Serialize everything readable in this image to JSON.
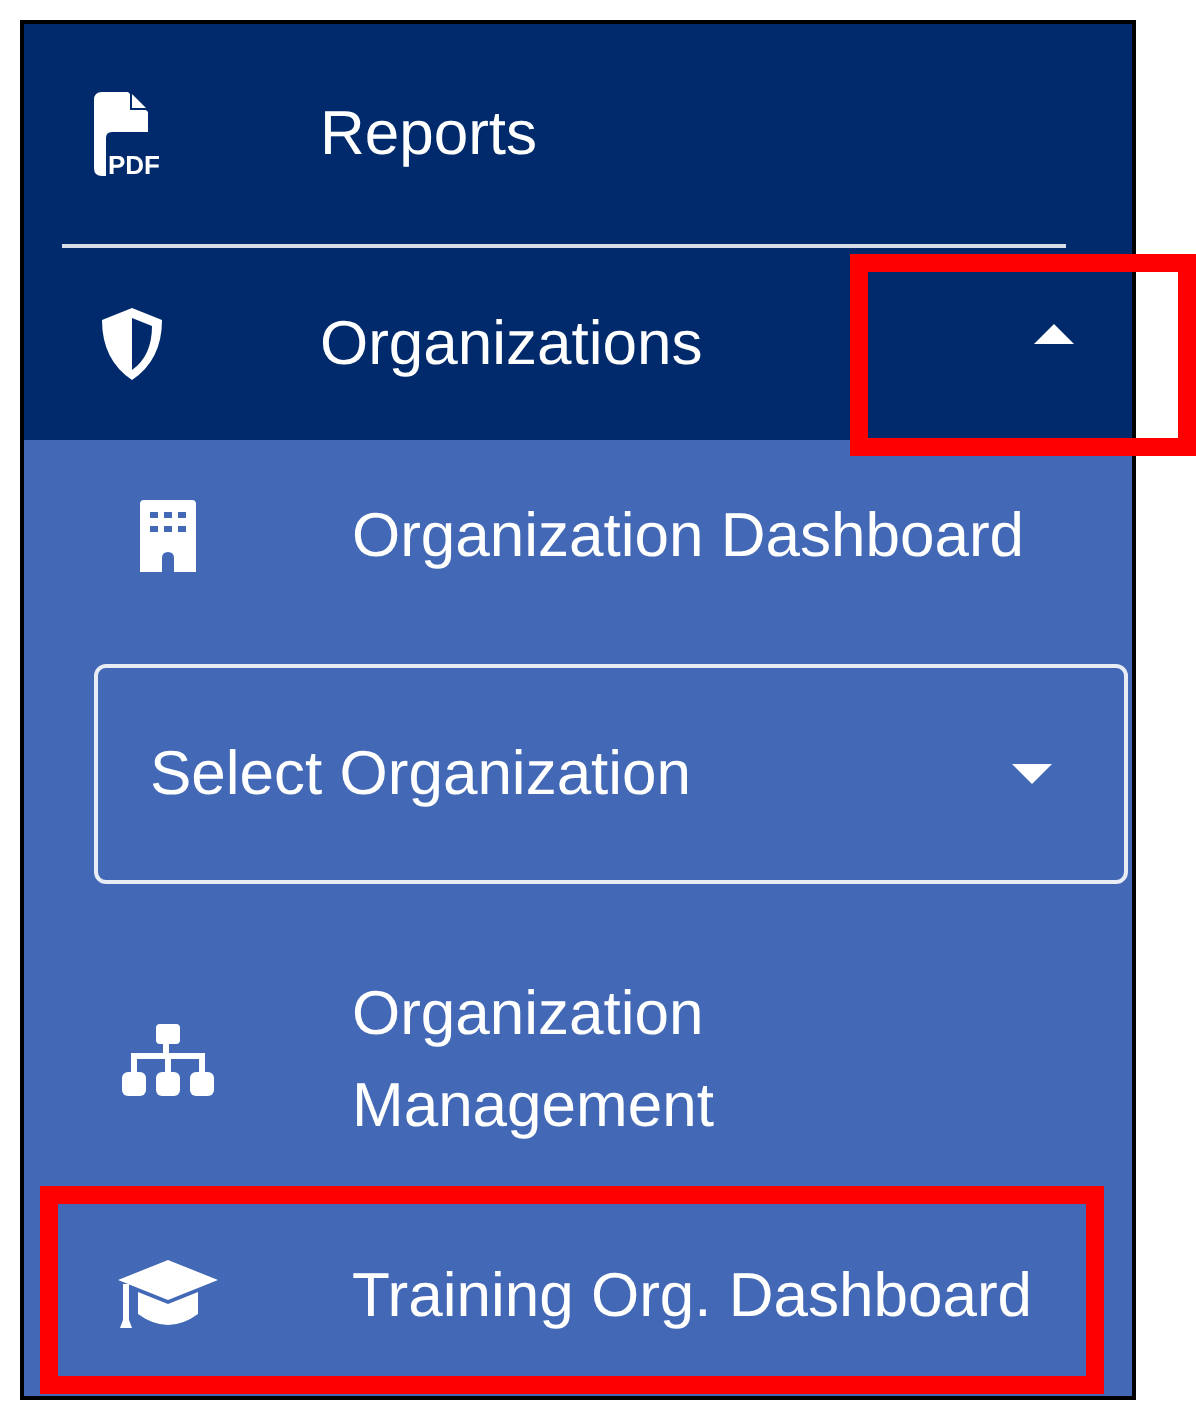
{
  "menu": [
    {
      "kind": "link",
      "icon_caption": "PDF",
      "label": "Reports",
      "highlighted": false
    },
    {
      "kind": "group",
      "label": "Organizations",
      "expanded": true,
      "highlighted": true,
      "children": [
        {
          "kind": "link",
          "label": "Organization Dashboard",
          "highlighted": false
        },
        {
          "kind": "select",
          "placeholder": "Select Organization"
        },
        {
          "kind": "link",
          "label": "Organization Management",
          "highlighted": false
        },
        {
          "kind": "link",
          "label": "Training Org. Dashboard",
          "highlighted": true
        }
      ]
    }
  ]
}
